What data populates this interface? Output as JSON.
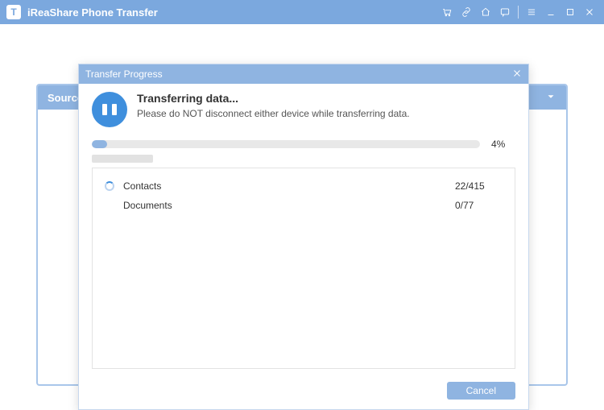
{
  "app": {
    "title": "iReaShare Phone Transfer",
    "logo_letter": "T"
  },
  "background": {
    "source_label": "Source:"
  },
  "modal": {
    "title": "Transfer Progress",
    "heading": "Transferring data...",
    "subheading": "Please do NOT disconnect either device while transferring data.",
    "progress_percent_label": "4%",
    "progress_percent_value": 4,
    "items": [
      {
        "name": "Contacts",
        "count": "22/415",
        "spinning": true
      },
      {
        "name": "Documents",
        "count": "0/77",
        "spinning": false
      }
    ],
    "cancel_label": "Cancel"
  }
}
